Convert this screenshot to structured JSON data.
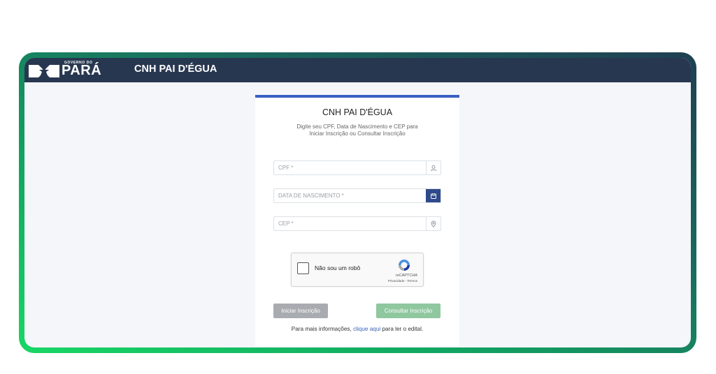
{
  "header": {
    "logo_small": "GOVERNO DO",
    "logo_big": "PARÁ",
    "app_title": "CNH PAI D'ÉGUA"
  },
  "card": {
    "title": "CNH PAI D'ÉGUA",
    "subtitle_line1": "Digite seu CPF, Data de Nascimento e CEP para",
    "subtitle_line2": "Iniciar Inscrição ou Consultar Inscrição",
    "fields": {
      "cpf": {
        "placeholder": "CPF *",
        "value": "",
        "icon": "user-icon"
      },
      "birthdate": {
        "placeholder": "DATA DE NASCIMENTO *",
        "value": "",
        "icon": "calendar-icon"
      },
      "cep": {
        "placeholder": "CEP *",
        "value": "",
        "icon": "location-pin-icon"
      }
    },
    "captcha": {
      "label": "Não sou um robô",
      "brand": "reCAPTCHA",
      "links": "Privacidade - Termos"
    },
    "buttons": {
      "start_label": "Iniciar Inscrição",
      "check_label": "Consultar Inscrição"
    },
    "info": {
      "prefix": "Para mais informações, ",
      "link": "clique aqui",
      "suffix": " para ler o edital."
    }
  },
  "colors": {
    "topbar": "#283750",
    "accent_blue": "#3a5fc4",
    "calendar_button": "#2e4a8a",
    "start_button": "#a8abb0",
    "check_button": "#8fc79f",
    "frame_green": "#19d765"
  }
}
